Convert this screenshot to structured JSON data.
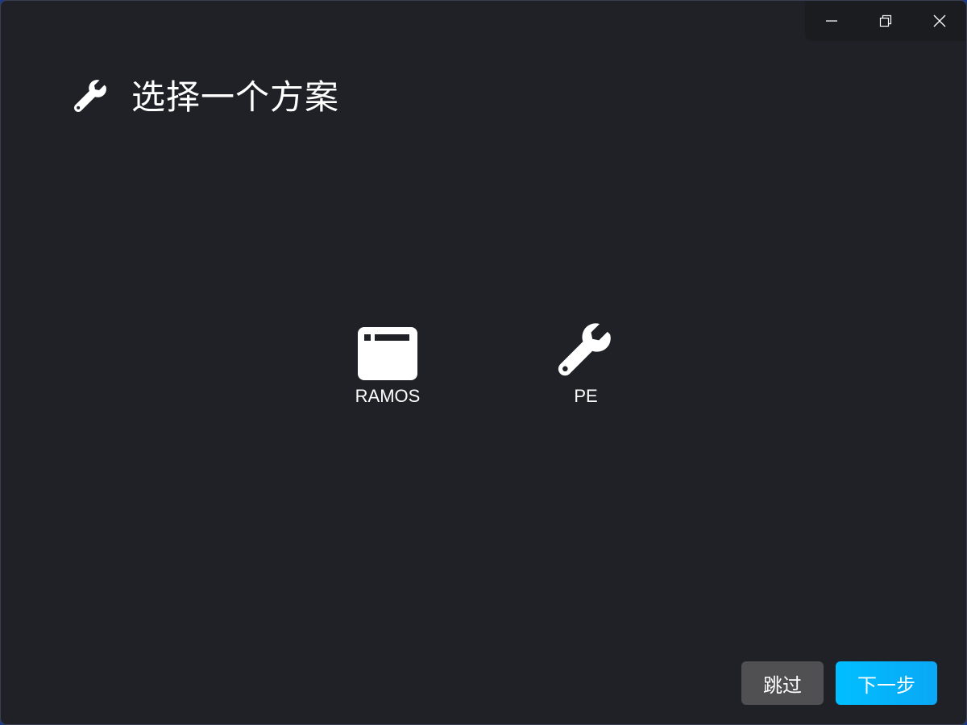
{
  "header": {
    "icon": "wrench-icon",
    "title": "选择一个方案"
  },
  "caption_buttons": [
    {
      "name": "minimize",
      "icon": "minimize-icon"
    },
    {
      "name": "maximize",
      "icon": "restore-icon"
    },
    {
      "name": "close",
      "icon": "close-icon"
    }
  ],
  "options": [
    {
      "label": "RAMOS",
      "icon": "window-icon"
    },
    {
      "label": "PE",
      "icon": "wrench-icon"
    }
  ],
  "buttons": {
    "skip_label": "跳过",
    "next_label": "下一步"
  },
  "colors": {
    "window_bg": "#202126",
    "caption_bg": "#1b1c20",
    "skip_bg": "#505052",
    "next_bg": "#00bfff",
    "text": "#ffffff"
  }
}
